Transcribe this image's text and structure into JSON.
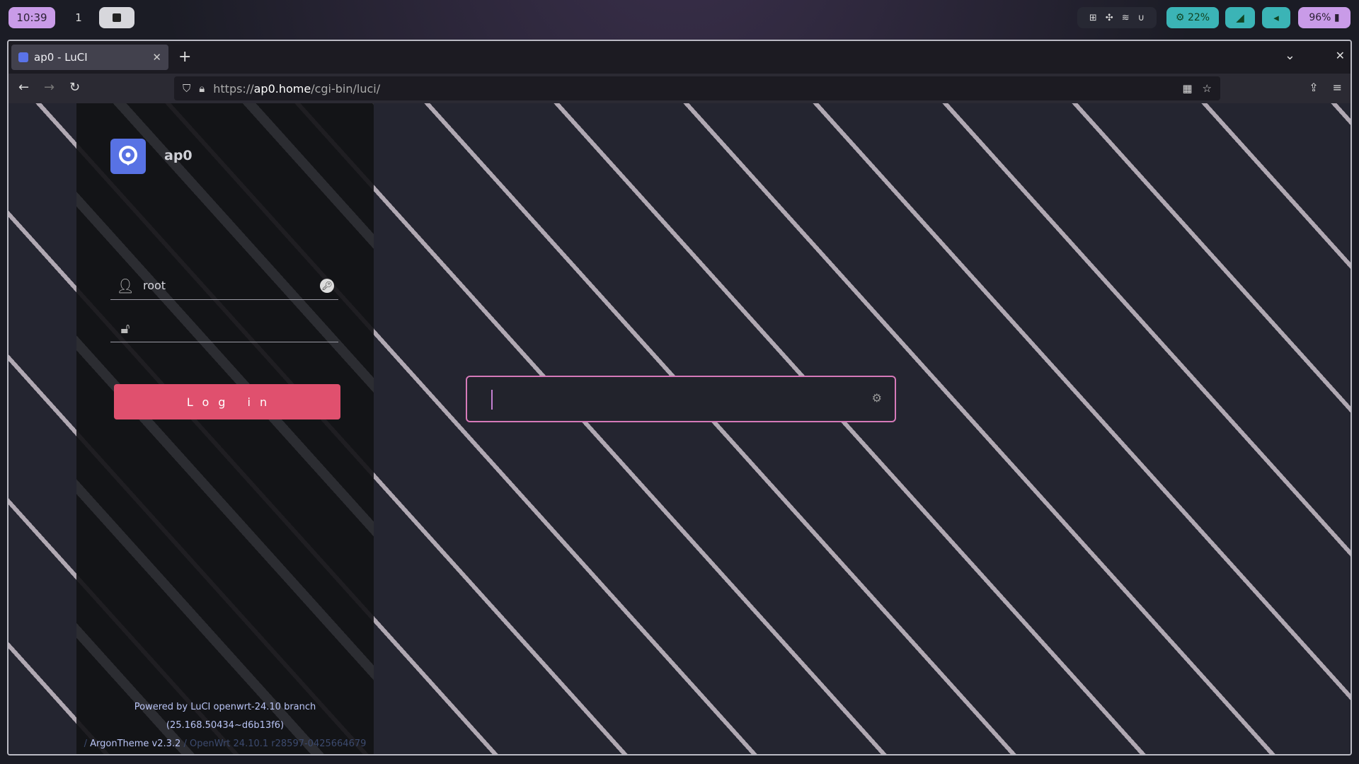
{
  "topbar": {
    "clock": "10:39",
    "workspace": "1",
    "cpu": "22%",
    "battery": "96%",
    "icons": [
      "grid-icon",
      "app-icon",
      "wifi-icon",
      "magnet-icon",
      "cpu-icon",
      "network-icon",
      "volume-icon",
      "battery-icon"
    ]
  },
  "browser": {
    "tab_title": "ap0 - LuCI",
    "new_tab": "+",
    "url_prefix": "https://",
    "url_host": "ap0.home",
    "url_path": "/cgi-bin/luci/"
  },
  "login": {
    "hostname": "ap0",
    "username": "root",
    "password": "",
    "button_label": "Log in"
  },
  "footer": {
    "powered": "Powered by LuCI openwrt-24.10 branch (25.168.50434~d6b13f6)",
    "theme": "ArgonTheme v2.3.2",
    "openwrt": "OpenWrt 24.10.1 r28597-0425664679"
  },
  "colors": {
    "accent": "#e0506e",
    "logo": "#5872e4",
    "launcher_border": "#d67ab9",
    "topbar_purple": "#c99be8",
    "topbar_teal": "#3bb4b6"
  }
}
